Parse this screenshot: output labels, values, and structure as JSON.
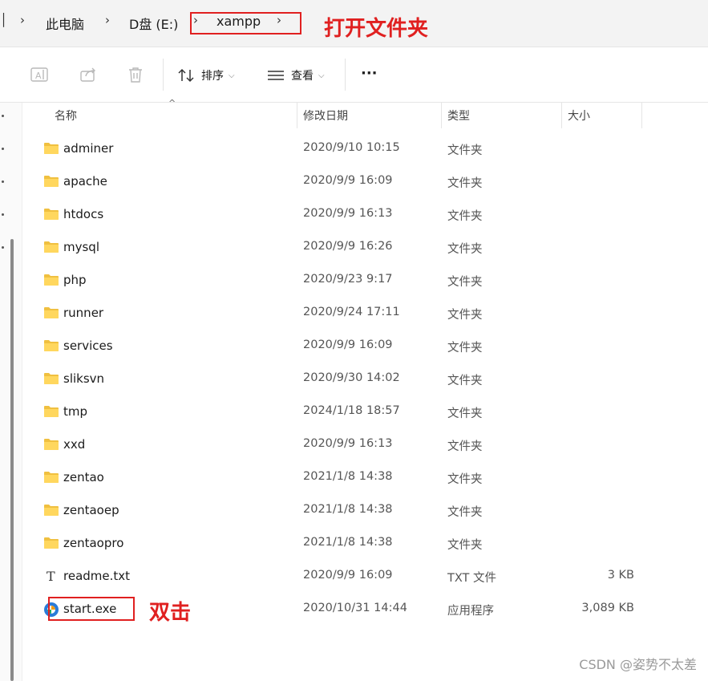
{
  "breadcrumb": {
    "items": [
      "此电脑",
      "D盘 (E:)",
      "xampp"
    ]
  },
  "annotations": {
    "open_folder": "打开文件夹",
    "double_click": "双击",
    "color": "#e02020"
  },
  "toolbar": {
    "sort_label": "排序",
    "view_label": "查看",
    "more_label": "···"
  },
  "columns": [
    "名称",
    "修改日期",
    "类型",
    "大小"
  ],
  "files": [
    {
      "name": "adminer",
      "date": "2020/9/10 10:15",
      "type": "文件夹",
      "size": "",
      "icon": "folder-icon"
    },
    {
      "name": "apache",
      "date": "2020/9/9 16:09",
      "type": "文件夹",
      "size": "",
      "icon": "folder-icon"
    },
    {
      "name": "htdocs",
      "date": "2020/9/9 16:13",
      "type": "文件夹",
      "size": "",
      "icon": "folder-icon"
    },
    {
      "name": "mysql",
      "date": "2020/9/9 16:26",
      "type": "文件夹",
      "size": "",
      "icon": "folder-icon"
    },
    {
      "name": "php",
      "date": "2020/9/23 9:17",
      "type": "文件夹",
      "size": "",
      "icon": "folder-icon"
    },
    {
      "name": "runner",
      "date": "2020/9/24 17:11",
      "type": "文件夹",
      "size": "",
      "icon": "folder-icon"
    },
    {
      "name": "services",
      "date": "2020/9/9 16:09",
      "type": "文件夹",
      "size": "",
      "icon": "folder-icon"
    },
    {
      "name": "sliksvn",
      "date": "2020/9/30 14:02",
      "type": "文件夹",
      "size": "",
      "icon": "folder-icon"
    },
    {
      "name": "tmp",
      "date": "2024/1/18 18:57",
      "type": "文件夹",
      "size": "",
      "icon": "folder-icon"
    },
    {
      "name": "xxd",
      "date": "2020/9/9 16:13",
      "type": "文件夹",
      "size": "",
      "icon": "folder-icon"
    },
    {
      "name": "zentao",
      "date": "2021/1/8 14:38",
      "type": "文件夹",
      "size": "",
      "icon": "folder-icon"
    },
    {
      "name": "zentaoep",
      "date": "2021/1/8 14:38",
      "type": "文件夹",
      "size": "",
      "icon": "folder-icon"
    },
    {
      "name": "zentaopro",
      "date": "2021/1/8 14:38",
      "type": "文件夹",
      "size": "",
      "icon": "folder-icon"
    },
    {
      "name": "readme.txt",
      "date": "2020/9/9 16:09",
      "type": "TXT 文件",
      "size": "3 KB",
      "icon": "text-file-icon"
    },
    {
      "name": "start.exe",
      "date": "2020/10/31 14:44",
      "type": "应用程序",
      "size": "3,089 KB",
      "icon": "exe-icon"
    }
  ],
  "watermark": "CSDN @姿势不太差"
}
